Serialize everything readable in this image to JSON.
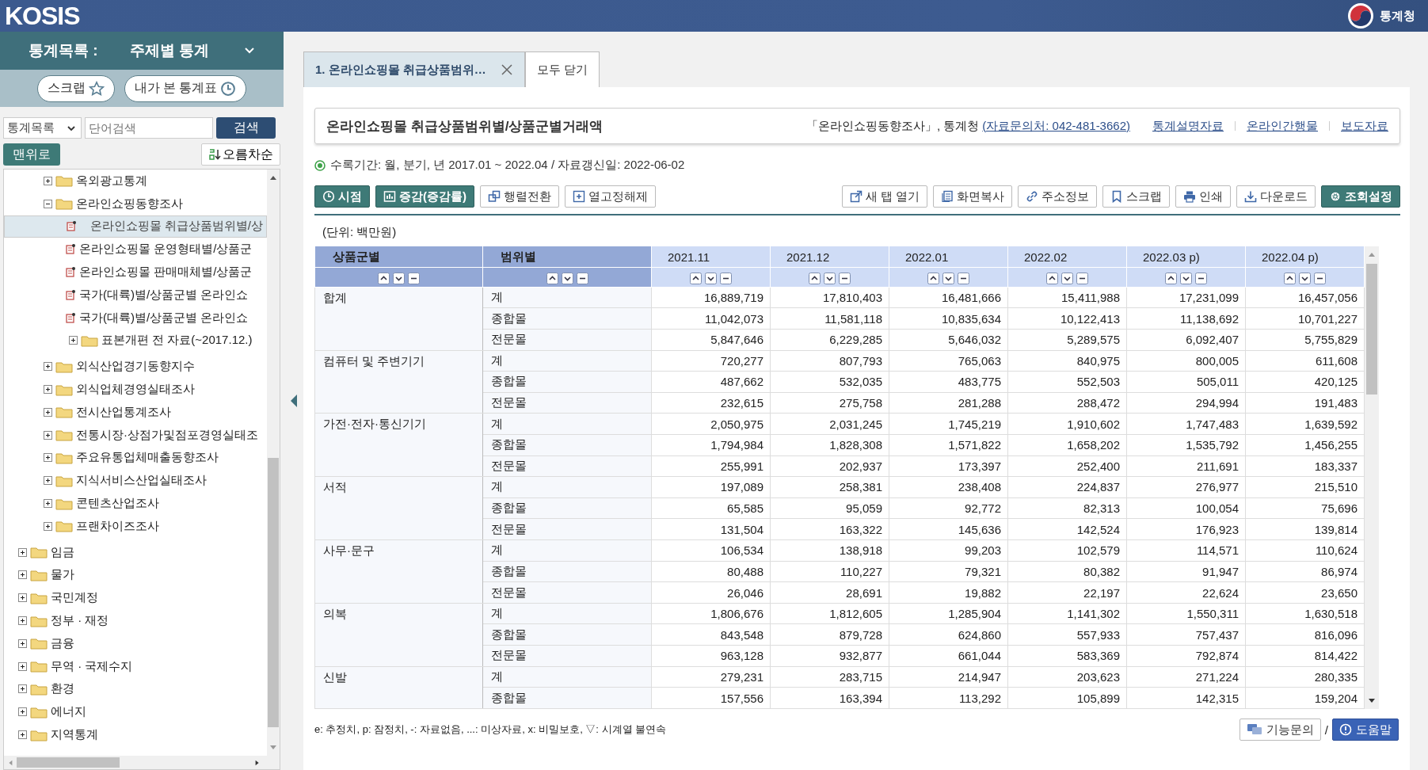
{
  "header": {
    "logo": "KOSIS",
    "agency": "통계청"
  },
  "sidebar": {
    "title_label": "통계목록 :",
    "title_value": "주제별 통계",
    "quick_buttons": [
      {
        "label": "스크랩"
      },
      {
        "label": "내가 본 통계표"
      }
    ],
    "search": {
      "select": "통계목록",
      "placeholder": "단어검색",
      "button": "검색"
    },
    "top_button": "맨위로",
    "sort_button": "오름차순",
    "tree": {
      "scrolled_branch": [
        {
          "label": "옥외광고통계",
          "expanded": false
        },
        {
          "label": "온라인쇼핑동향조사",
          "expanded": true,
          "children": [
            {
              "label": "온라인쇼핑몰 취급상품범위별/상",
              "kind": "table",
              "selected": true
            },
            {
              "label": "온라인쇼핑몰 운영형태별/상품군",
              "kind": "table",
              "selected": false
            },
            {
              "label": "온라인쇼핑몰 판매매체별/상품군",
              "kind": "table",
              "selected": false
            },
            {
              "label": "국가(대륙)별/상품군별 온라인쇼",
              "kind": "table",
              "selected": false
            },
            {
              "label": "국가(대륙)별/상품군별 온라인쇼",
              "kind": "table",
              "selected": false
            },
            {
              "label": "표본개편 전 자료(~2017.12.)",
              "kind": "folder",
              "expanded": false
            }
          ]
        },
        {
          "label": "외식산업경기동향지수",
          "expanded": false
        },
        {
          "label": "외식업체경영실태조사",
          "expanded": false
        },
        {
          "label": "전시산업통계조사",
          "expanded": false
        },
        {
          "label": "전통시장·상점가및점포경영실태조",
          "expanded": false
        },
        {
          "label": "주요유통업체매출동향조사",
          "expanded": false
        },
        {
          "label": "지식서비스산업실태조사",
          "expanded": false
        },
        {
          "label": "콘텐츠산업조사",
          "expanded": false
        },
        {
          "label": "프랜차이즈조사",
          "expanded": false
        }
      ],
      "items": [
        {
          "label": "임금",
          "expanded": false
        },
        {
          "label": "물가",
          "expanded": false
        },
        {
          "label": "국민계정",
          "expanded": false
        },
        {
          "label": "정부 · 재정",
          "expanded": false
        },
        {
          "label": "금융",
          "expanded": false
        },
        {
          "label": "무역 · 국제수지",
          "expanded": false
        },
        {
          "label": "환경",
          "expanded": false
        },
        {
          "label": "에너지",
          "expanded": false
        },
        {
          "label": "지역통계",
          "expanded": false
        }
      ]
    }
  },
  "tabs": [
    {
      "label": "1. 온라인쇼핑몰 취급상품범위…",
      "selected": true,
      "closable": true
    },
    {
      "label": "모두 닫기",
      "selected": false,
      "closable": false
    }
  ],
  "stat": {
    "title": "온라인쇼핑몰 취급상품범위별/상품군별거래액",
    "source": "「온라인쇼핑동향조사」, 통계청",
    "contact": "(자료문의처: 042-481-3662)",
    "links": [
      "통계설명자료",
      "온라인간행물",
      "보도자료"
    ],
    "period": "수록기간: 월, 분기, 년 2017.01 ~ 2022.04 / 자료갱신일: 2022-06-02"
  },
  "toolbar_left": [
    {
      "label": "시점",
      "kind": "primary"
    },
    {
      "label": "증감(증감률)",
      "kind": "primary"
    },
    {
      "label": "행렬전환",
      "kind": "plain"
    },
    {
      "label": "열고정해제",
      "kind": "plain"
    }
  ],
  "toolbar_right": [
    {
      "label": "새 탭 열기",
      "kind": "plain"
    },
    {
      "label": "화면복사",
      "kind": "plain"
    },
    {
      "label": "주소정보",
      "kind": "plain"
    },
    {
      "label": "스크랩",
      "kind": "plain"
    },
    {
      "label": "인쇄",
      "kind": "plain"
    },
    {
      "label": "다운로드",
      "kind": "plain"
    },
    {
      "label": "조회설정",
      "kind": "primary"
    }
  ],
  "unit": "(단위: 백만원)",
  "table": {
    "columns": [
      "상품군별",
      "범위별",
      "2021.11",
      "2021.12",
      "2022.01",
      "2022.02",
      "2022.03 p)",
      "2022.04 p)"
    ],
    "groups": [
      {
        "name": "합계",
        "rows": [
          [
            "계",
            "16,889,719",
            "17,810,403",
            "16,481,666",
            "15,411,988",
            "17,231,099",
            "16,457,056"
          ],
          [
            "종합몰",
            "11,042,073",
            "11,581,118",
            "10,835,634",
            "10,122,413",
            "11,138,692",
            "10,701,227"
          ],
          [
            "전문몰",
            "5,847,646",
            "6,229,285",
            "5,646,032",
            "5,289,575",
            "6,092,407",
            "5,755,829"
          ]
        ]
      },
      {
        "name": "컴퓨터 및 주변기기",
        "rows": [
          [
            "계",
            "720,277",
            "807,793",
            "765,063",
            "840,975",
            "800,005",
            "611,608"
          ],
          [
            "종합몰",
            "487,662",
            "532,035",
            "483,775",
            "552,503",
            "505,011",
            "420,125"
          ],
          [
            "전문몰",
            "232,615",
            "275,758",
            "281,288",
            "288,472",
            "294,994",
            "191,483"
          ]
        ]
      },
      {
        "name": "가전·전자·통신기기",
        "rows": [
          [
            "계",
            "2,050,975",
            "2,031,245",
            "1,745,219",
            "1,910,602",
            "1,747,483",
            "1,639,592"
          ],
          [
            "종합몰",
            "1,794,984",
            "1,828,308",
            "1,571,822",
            "1,658,202",
            "1,535,792",
            "1,456,255"
          ],
          [
            "전문몰",
            "255,991",
            "202,937",
            "173,397",
            "252,400",
            "211,691",
            "183,337"
          ]
        ]
      },
      {
        "name": "서적",
        "rows": [
          [
            "계",
            "197,089",
            "258,381",
            "238,408",
            "224,837",
            "276,977",
            "215,510"
          ],
          [
            "종합몰",
            "65,585",
            "95,059",
            "92,772",
            "82,313",
            "100,054",
            "75,696"
          ],
          [
            "전문몰",
            "131,504",
            "163,322",
            "145,636",
            "142,524",
            "176,923",
            "139,814"
          ]
        ]
      },
      {
        "name": "사무·문구",
        "rows": [
          [
            "계",
            "106,534",
            "138,918",
            "99,203",
            "102,579",
            "114,571",
            "110,624"
          ],
          [
            "종합몰",
            "80,488",
            "110,227",
            "79,321",
            "80,382",
            "91,947",
            "86,974"
          ],
          [
            "전문몰",
            "26,046",
            "28,691",
            "19,882",
            "22,197",
            "22,624",
            "23,650"
          ]
        ]
      },
      {
        "name": "의복",
        "rows": [
          [
            "계",
            "1,806,676",
            "1,812,605",
            "1,285,904",
            "1,141,302",
            "1,550,311",
            "1,630,518"
          ],
          [
            "종합몰",
            "843,548",
            "879,728",
            "624,860",
            "557,933",
            "757,437",
            "816,096"
          ],
          [
            "전문몰",
            "963,128",
            "932,877",
            "661,044",
            "583,369",
            "792,874",
            "814,422"
          ]
        ]
      },
      {
        "name": "신발",
        "rows": [
          [
            "계",
            "279,231",
            "283,715",
            "214,947",
            "203,623",
            "271,224",
            "280,335"
          ],
          [
            "종합몰",
            "157,556",
            "163,394",
            "113,292",
            "105,899",
            "142,315",
            "159,204"
          ]
        ]
      }
    ]
  },
  "footnote": "e: 추정치, p: 잠정치, -: 자료없음, ...: 미상자료, x: 비밀보호, ▽: 시계열 불연속",
  "help": {
    "inquiry": "기능문의",
    "separator": "/",
    "help": "도움말"
  }
}
